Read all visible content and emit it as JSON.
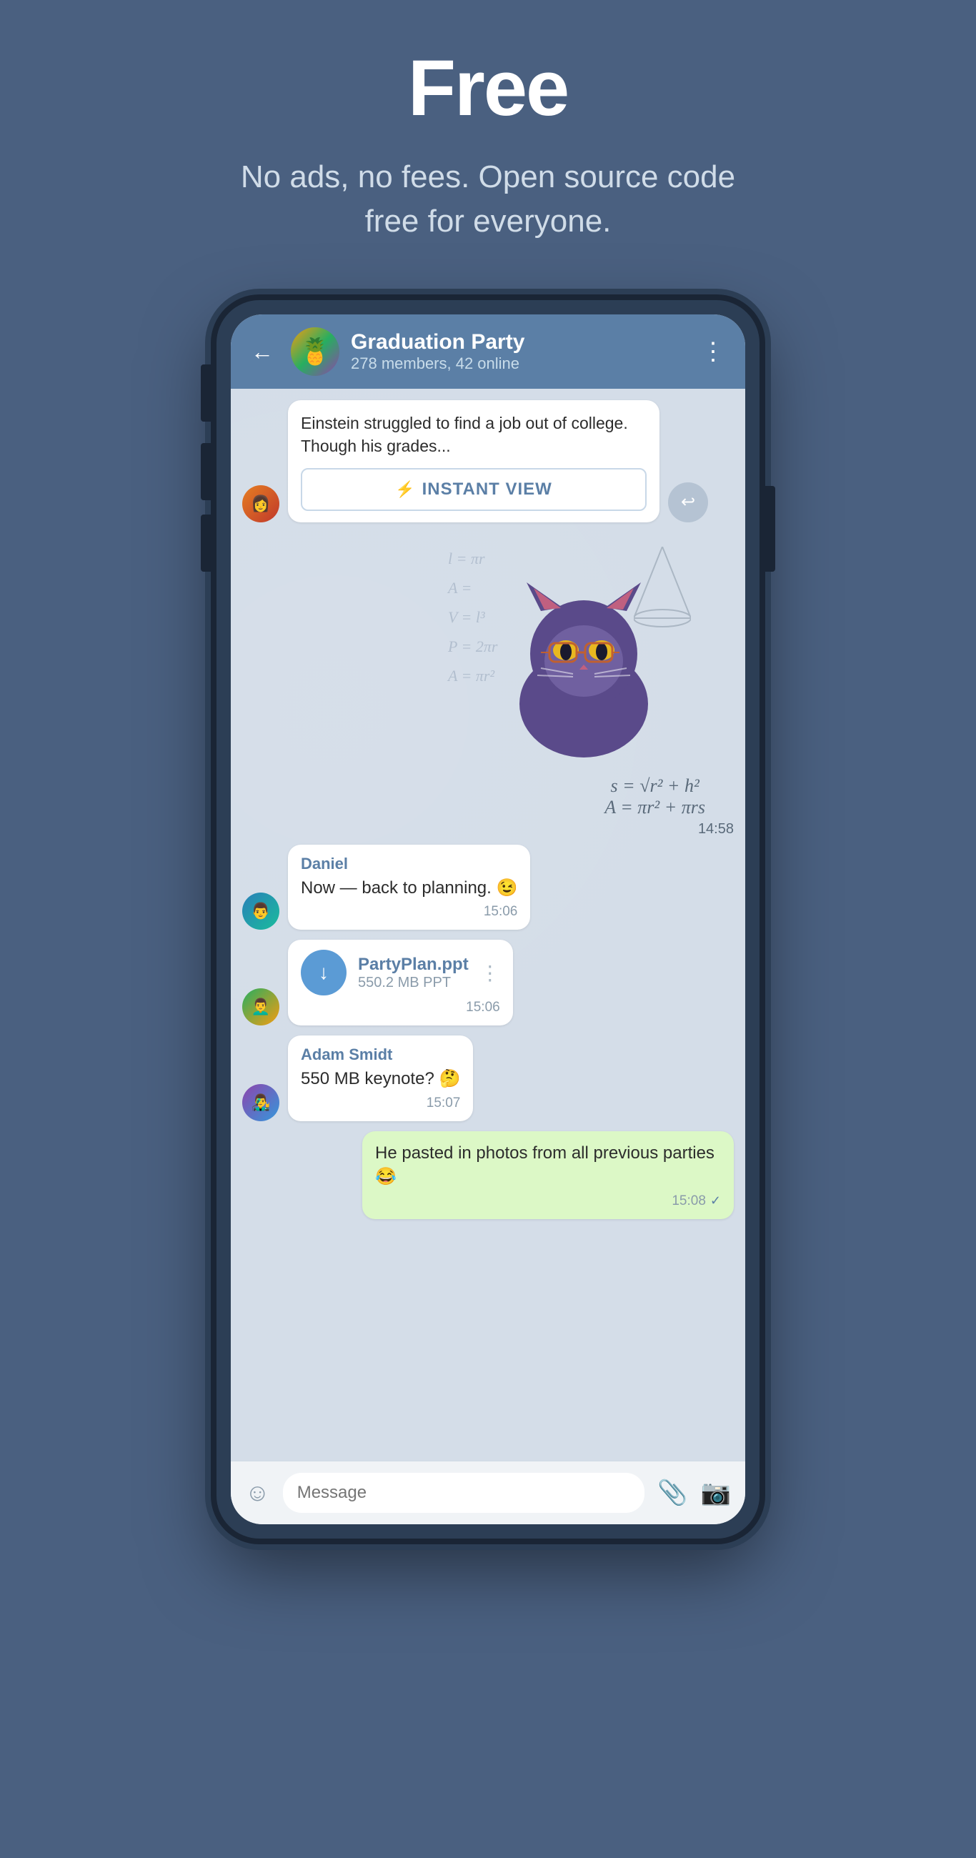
{
  "page": {
    "hero_title": "Free",
    "hero_subtitle": "No ads, no fees. Open source code free for everyone."
  },
  "chat": {
    "back_label": "←",
    "group_name": "Graduation Party",
    "group_status": "278 members, 42 online",
    "more_label": "⋮",
    "avatar_emoji": "🍍",
    "messages": [
      {
        "id": "article-msg",
        "type": "article",
        "article_text": "Einstein struggled to find a job out of college. Though his grades...",
        "instant_view_icon": "⚡",
        "instant_view_label": "INSTANT VIEW",
        "forward_icon": "↩"
      },
      {
        "id": "sticker-msg",
        "type": "sticker",
        "time": "14:58"
      },
      {
        "id": "daniel-msg",
        "type": "text",
        "sender": "Daniel",
        "text": "Now — back to planning. 😉",
        "time": "15:06"
      },
      {
        "id": "file-msg",
        "type": "file",
        "file_name": "PartyPlan.ppt",
        "file_size": "550.2 MB PPT",
        "download_icon": "↓",
        "time": "15:06"
      },
      {
        "id": "adam-msg",
        "type": "text",
        "sender": "Adam Smidt",
        "text": "550 MB keynote? 🤔",
        "time": "15:07"
      },
      {
        "id": "own-msg",
        "type": "text",
        "own": true,
        "text": "He pasted in photos from all previous parties 😂",
        "time": "15:08",
        "check": "✓"
      }
    ],
    "input_placeholder": "Message"
  }
}
